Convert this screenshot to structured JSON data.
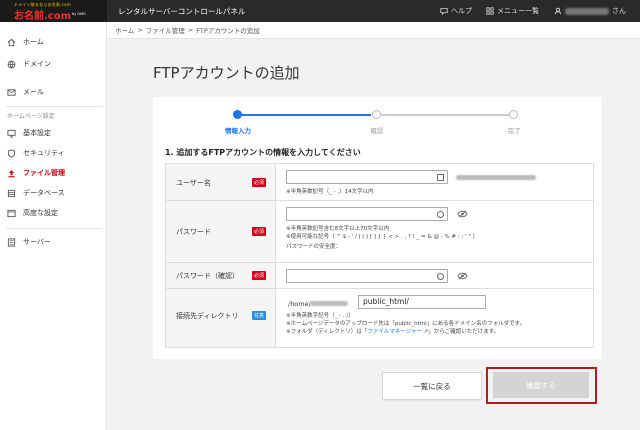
{
  "header": {
    "logo_sub": "ドメイン取るならお名前.com",
    "logo_main": "お名前.com",
    "logo_tag": "by GMO",
    "app_title": "レンタルサーバーコントロールパネル",
    "help": "ヘルプ",
    "menu": "メニュー一覧",
    "user_suffix": "さん"
  },
  "sidebar": {
    "items_top": [
      {
        "label": "ホーム",
        "icon": "home-icon"
      },
      {
        "label": "ドメイン",
        "icon": "globe-icon"
      },
      {
        "label": "メール",
        "icon": "mail-icon"
      }
    ],
    "section_label": "ホームページ設定",
    "items_hp": [
      {
        "label": "基本設定",
        "icon": "monitor-icon"
      },
      {
        "label": "セキュリティ",
        "icon": "shield-icon"
      },
      {
        "label": "ファイル管理",
        "icon": "upload-icon"
      },
      {
        "label": "データベース",
        "icon": "database-icon"
      },
      {
        "label": "高度な設定",
        "icon": "settings-window-icon"
      }
    ],
    "item_server": {
      "label": "サーバー",
      "icon": "server-icon"
    }
  },
  "breadcrumb": [
    "ホーム",
    "ファイル管理",
    "FTPアカウントの追加"
  ],
  "breadcrumb_sep": ">",
  "page_title": "FTPアカウントの追加",
  "steps": [
    {
      "label": "情報入力",
      "active": true
    },
    {
      "label": "確認",
      "active": false
    },
    {
      "label": "完了",
      "active": false
    }
  ],
  "section_heading": "1. 追加するFTPアカウントの情報を入力してください",
  "form": {
    "username": {
      "label": "ユーザー名",
      "badge": "必須",
      "note": "※半角英数記号（_ - .）14文字以内"
    },
    "password": {
      "label": "パスワード",
      "badge": "必須",
      "notes": [
        "※半角英数記号含む8文字以上70文字以内",
        "※使用可能な記号（ ^ $ - ' / | ( ) [ ] { } < > . , ? ! _ = & @ - % # : ; ' \" ）",
        "パスワードの安全度："
      ]
    },
    "password_confirm": {
      "label": "パスワード（確認）",
      "badge": "必須"
    },
    "directory": {
      "label": "接続先ディレクトリ",
      "badge": "任意",
      "prefix": "/home/",
      "value": "public_html/",
      "notes": [
        "※半角英数字記号（_ - . /）",
        "※ホームページデータのアップロード先は「public_html」にある各ドメイン名のフォルダです。",
        "※フォルダ（ディレクトリ）は「",
        "ファイルマネージャー",
        "」からご確認いただけます。"
      ]
    }
  },
  "buttons": {
    "back": "一覧に戻る",
    "confirm": "確認する"
  },
  "colors": {
    "accent": "#1a73e8",
    "active_nav": "#c7000b",
    "required_badge": "#d0021b",
    "optional_badge": "#2b8de0",
    "highlight_frame": "#b01d1d"
  }
}
